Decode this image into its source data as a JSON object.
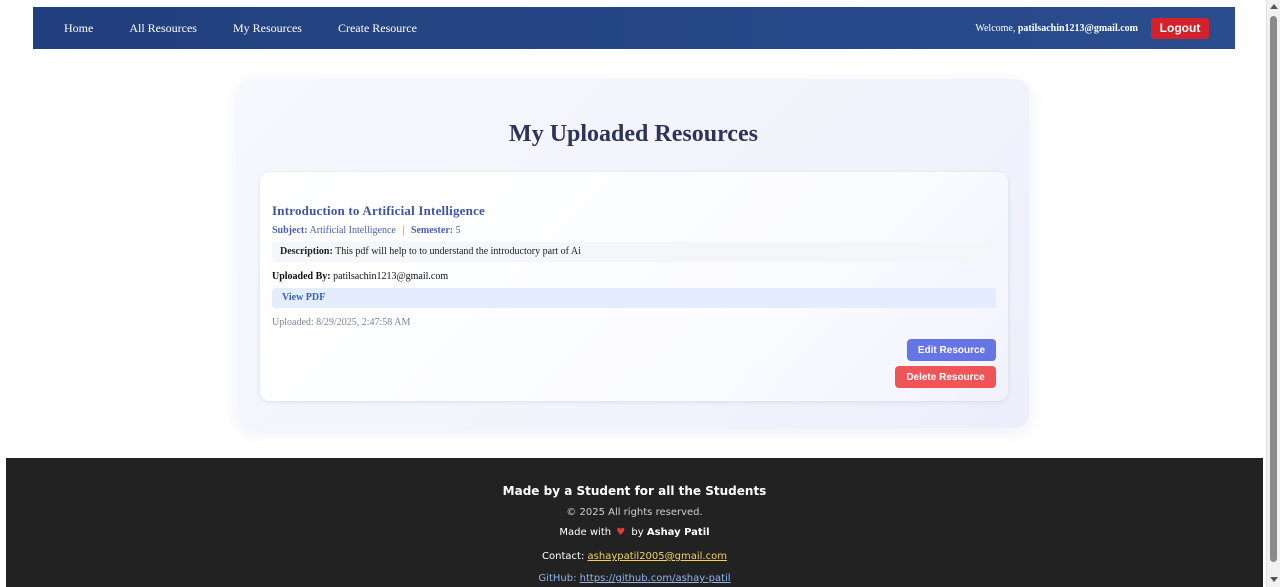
{
  "nav": {
    "links": [
      "Home",
      "All Resources",
      "My Resources",
      "Create Resource"
    ],
    "welcome_prefix": "Welcome,",
    "user_email": "patilsachin1213@gmail.com",
    "logout_label": "Logout"
  },
  "page": {
    "title": "My Uploaded Resources"
  },
  "resource": {
    "title": "Introduction to Artificial Intelligence",
    "subject_label": "Subject:",
    "subject": "Artificial Intelligence",
    "separator": "|",
    "semester_label": "Semester:",
    "semester": "5",
    "description_label": "Description:",
    "description": "This pdf will help to to understand the introductory part of Ai",
    "uploaded_by_label": "Uploaded By:",
    "uploaded_by": "patilsachin1213@gmail.com",
    "view_pdf_label": "View PDF",
    "uploaded_at": "Uploaded: 8/29/2025, 2:47:58 AM",
    "edit_label": "Edit Resource",
    "delete_label": "Delete Resource"
  },
  "footer": {
    "headline": "Made by a Student for all the Students",
    "copyright": "© 2025 All rights reserved.",
    "made_with_prefix": "Made with",
    "made_with_suffix": "by",
    "author": "Ashay Patil",
    "contact_label": "Contact:",
    "contact_email": "ashaypatil2005@gmail.com",
    "github_label": "GitHub:",
    "github_url": "https://github.com/ashay-patil"
  },
  "colors": {
    "navbar": "#213f7c",
    "logout": "#d4222a",
    "edit": "#6674e6",
    "delete": "#ef5456",
    "footer": "#222222"
  },
  "icons": {
    "heart": "heart-icon"
  }
}
